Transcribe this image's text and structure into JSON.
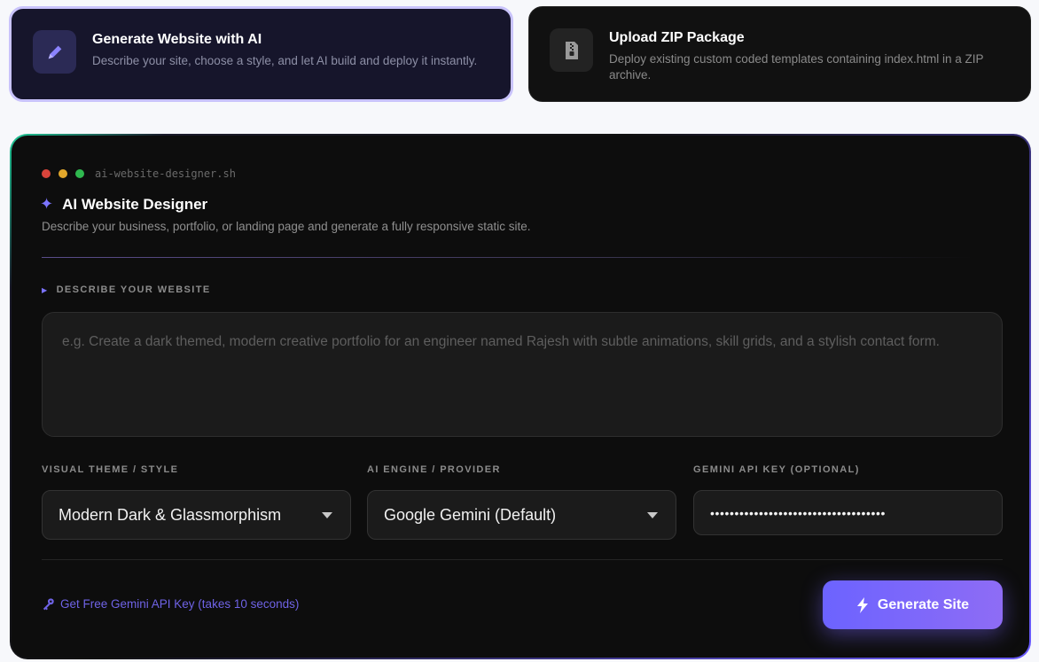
{
  "modes": {
    "ai": {
      "title": "Generate Website with AI",
      "description": "Describe your site, choose a style, and let AI build and deploy it instantly.",
      "icon": "pencil-icon"
    },
    "zip": {
      "title": "Upload ZIP Package",
      "description": "Deploy existing custom coded templates containing index.html in a ZIP archive.",
      "icon": "zip-file-icon"
    }
  },
  "designer": {
    "script_name": "ai-website-designer.sh",
    "title": "AI Website Designer",
    "subtitle": "Describe your business, portfolio, or landing page and generate a fully responsive static site."
  },
  "describe": {
    "label": "DESCRIBE YOUR WEBSITE",
    "placeholder": "e.g. Create a dark themed, modern creative portfolio for an engineer named Rajesh with subtle animations, skill grids, and a stylish contact form."
  },
  "theme": {
    "label": "VISUAL THEME / STYLE",
    "selected": "Modern Dark & Glassmorphism"
  },
  "engine": {
    "label": "AI ENGINE / PROVIDER",
    "selected": "Google Gemini (Default)"
  },
  "api_key": {
    "label": "GEMINI API KEY (OPTIONAL)",
    "masked_value": "••••••••••••••••••••••••••••••••••••"
  },
  "footer": {
    "free_key_link": "Get Free Gemini API Key (takes 10 seconds)",
    "generate_label": "Generate Site"
  },
  "colors": {
    "accent": "#6c63ff",
    "link": "#6f63e6",
    "panel_bg": "#0d0d0d"
  }
}
